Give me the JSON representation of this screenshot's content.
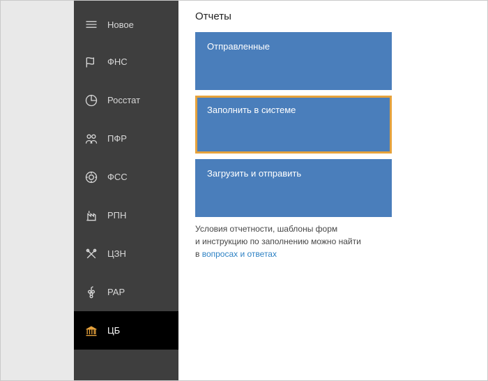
{
  "sidebar": {
    "items": [
      {
        "label": "Новое",
        "icon": "new"
      },
      {
        "label": "ФНС",
        "icon": "flag"
      },
      {
        "label": "Росстат",
        "icon": "pie"
      },
      {
        "label": "ПФР",
        "icon": "people"
      },
      {
        "label": "ФСС",
        "icon": "target"
      },
      {
        "label": "РПН",
        "icon": "factory"
      },
      {
        "label": "ЦЗН",
        "icon": "tools"
      },
      {
        "label": "РАР",
        "icon": "grapes"
      },
      {
        "label": "ЦБ",
        "icon": "bank",
        "active": true
      }
    ]
  },
  "main": {
    "title": "Отчеты",
    "tiles": [
      {
        "label": "Отправленные"
      },
      {
        "label": "Заполнить в системе",
        "highlight": true
      },
      {
        "label": "Загрузить и отправить"
      }
    ],
    "help": {
      "line1": "Условия отчетности, шаблоны форм",
      "line2": "и инструкцию по заполнению можно найти",
      "line3_prefix": "в ",
      "link_text": "вопросах и ответах"
    }
  }
}
